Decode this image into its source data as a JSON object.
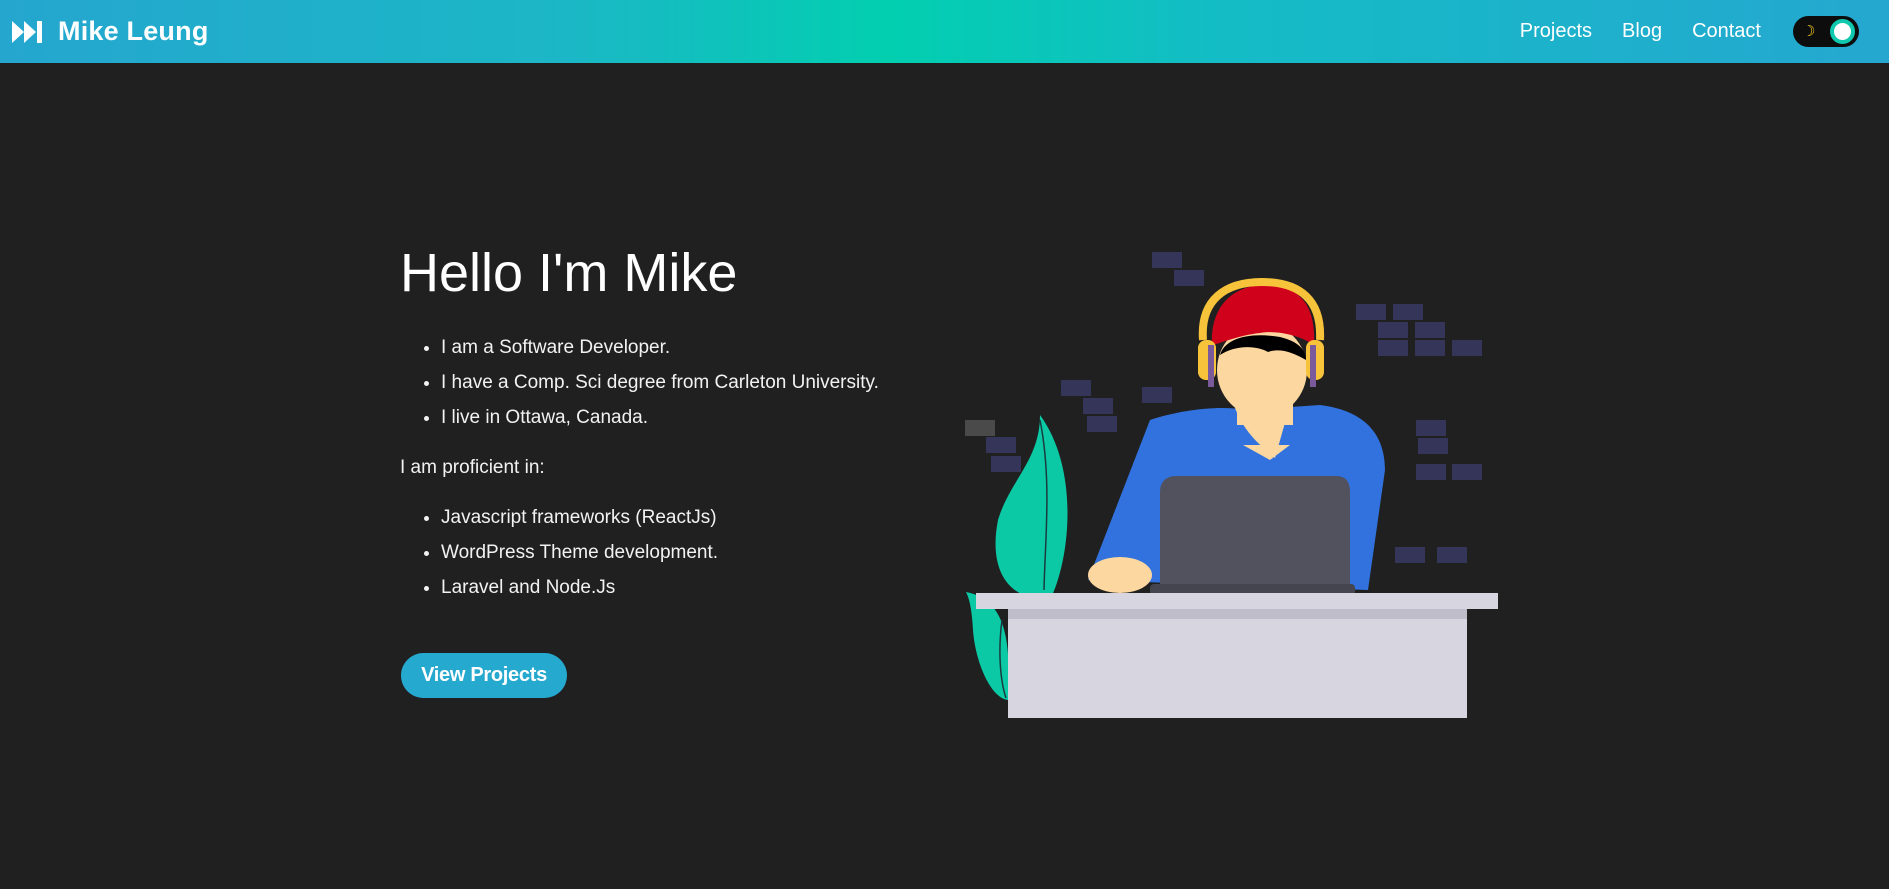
{
  "brand": {
    "icon": "fast-forward-icon",
    "name": "Mike Leung"
  },
  "nav": {
    "links": [
      "Projects",
      "Blog",
      "Contact"
    ]
  },
  "theme_toggle": {
    "icon": "moon-icon",
    "state": "on"
  },
  "hero": {
    "title": "Hello I'm Mike",
    "about": [
      "I am a Software Developer.",
      "I have a Comp. Sci degree from Carleton University.",
      "I live in Ottawa, Canada."
    ],
    "proficient_label": "I am proficient in:",
    "skills": [
      "Javascript frameworks (ReactJs)",
      "WordPress Theme development.",
      "Laravel and Node.Js"
    ],
    "cta_label": "View Projects"
  },
  "illustration": {
    "name": "developer-at-desk-illustration"
  },
  "colors": {
    "background": "#202020",
    "nav_gradient_start": "#25a6cf",
    "nav_gradient_mid": "#02cfb0",
    "button": "#26a9cf",
    "toggle_knob_ring": "#0fc8ae",
    "moon": "#f6cd23"
  }
}
